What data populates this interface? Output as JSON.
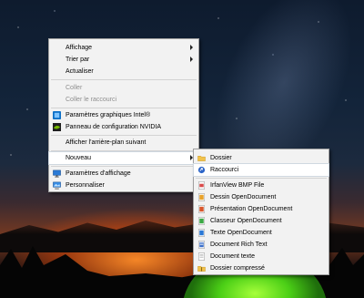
{
  "context_menu": {
    "items": [
      {
        "label": "Affichage",
        "submenu": true
      },
      {
        "label": "Trier par",
        "submenu": true
      },
      {
        "label": "Actualiser"
      },
      {
        "label": "Coller",
        "disabled": true
      },
      {
        "label": "Coller le raccourci",
        "disabled": true
      },
      {
        "label": "Paramètres graphiques Intel®",
        "icon": "intel-graphics-icon"
      },
      {
        "label": "Panneau de configuration NVIDIA",
        "icon": "nvidia-icon"
      },
      {
        "label": "Afficher l'arrière-plan suivant"
      },
      {
        "label": "Nouveau",
        "submenu": true,
        "highlighted": true
      },
      {
        "label": "Paramètres d'affichage",
        "icon": "display-settings-icon"
      },
      {
        "label": "Personnaliser",
        "icon": "personalize-icon"
      }
    ]
  },
  "submenu_nouveau": {
    "items": [
      {
        "label": "Dossier",
        "icon": "folder-icon"
      },
      {
        "label": "Raccourci",
        "icon": "shortcut-icon",
        "highlighted": true
      },
      {
        "label": "IrfanView BMP File",
        "icon": "bmp-file-icon"
      },
      {
        "label": "Dessin OpenDocument",
        "icon": "odg-file-icon"
      },
      {
        "label": "Présentation OpenDocument",
        "icon": "odp-file-icon"
      },
      {
        "label": "Classeur OpenDocument",
        "icon": "ods-file-icon"
      },
      {
        "label": "Texte OpenDocument",
        "icon": "odt-file-icon"
      },
      {
        "label": "Document Rich Text",
        "icon": "rtf-file-icon"
      },
      {
        "label": "Document texte",
        "icon": "txt-file-icon"
      },
      {
        "label": "Dossier compressé",
        "icon": "zip-folder-icon"
      }
    ]
  }
}
